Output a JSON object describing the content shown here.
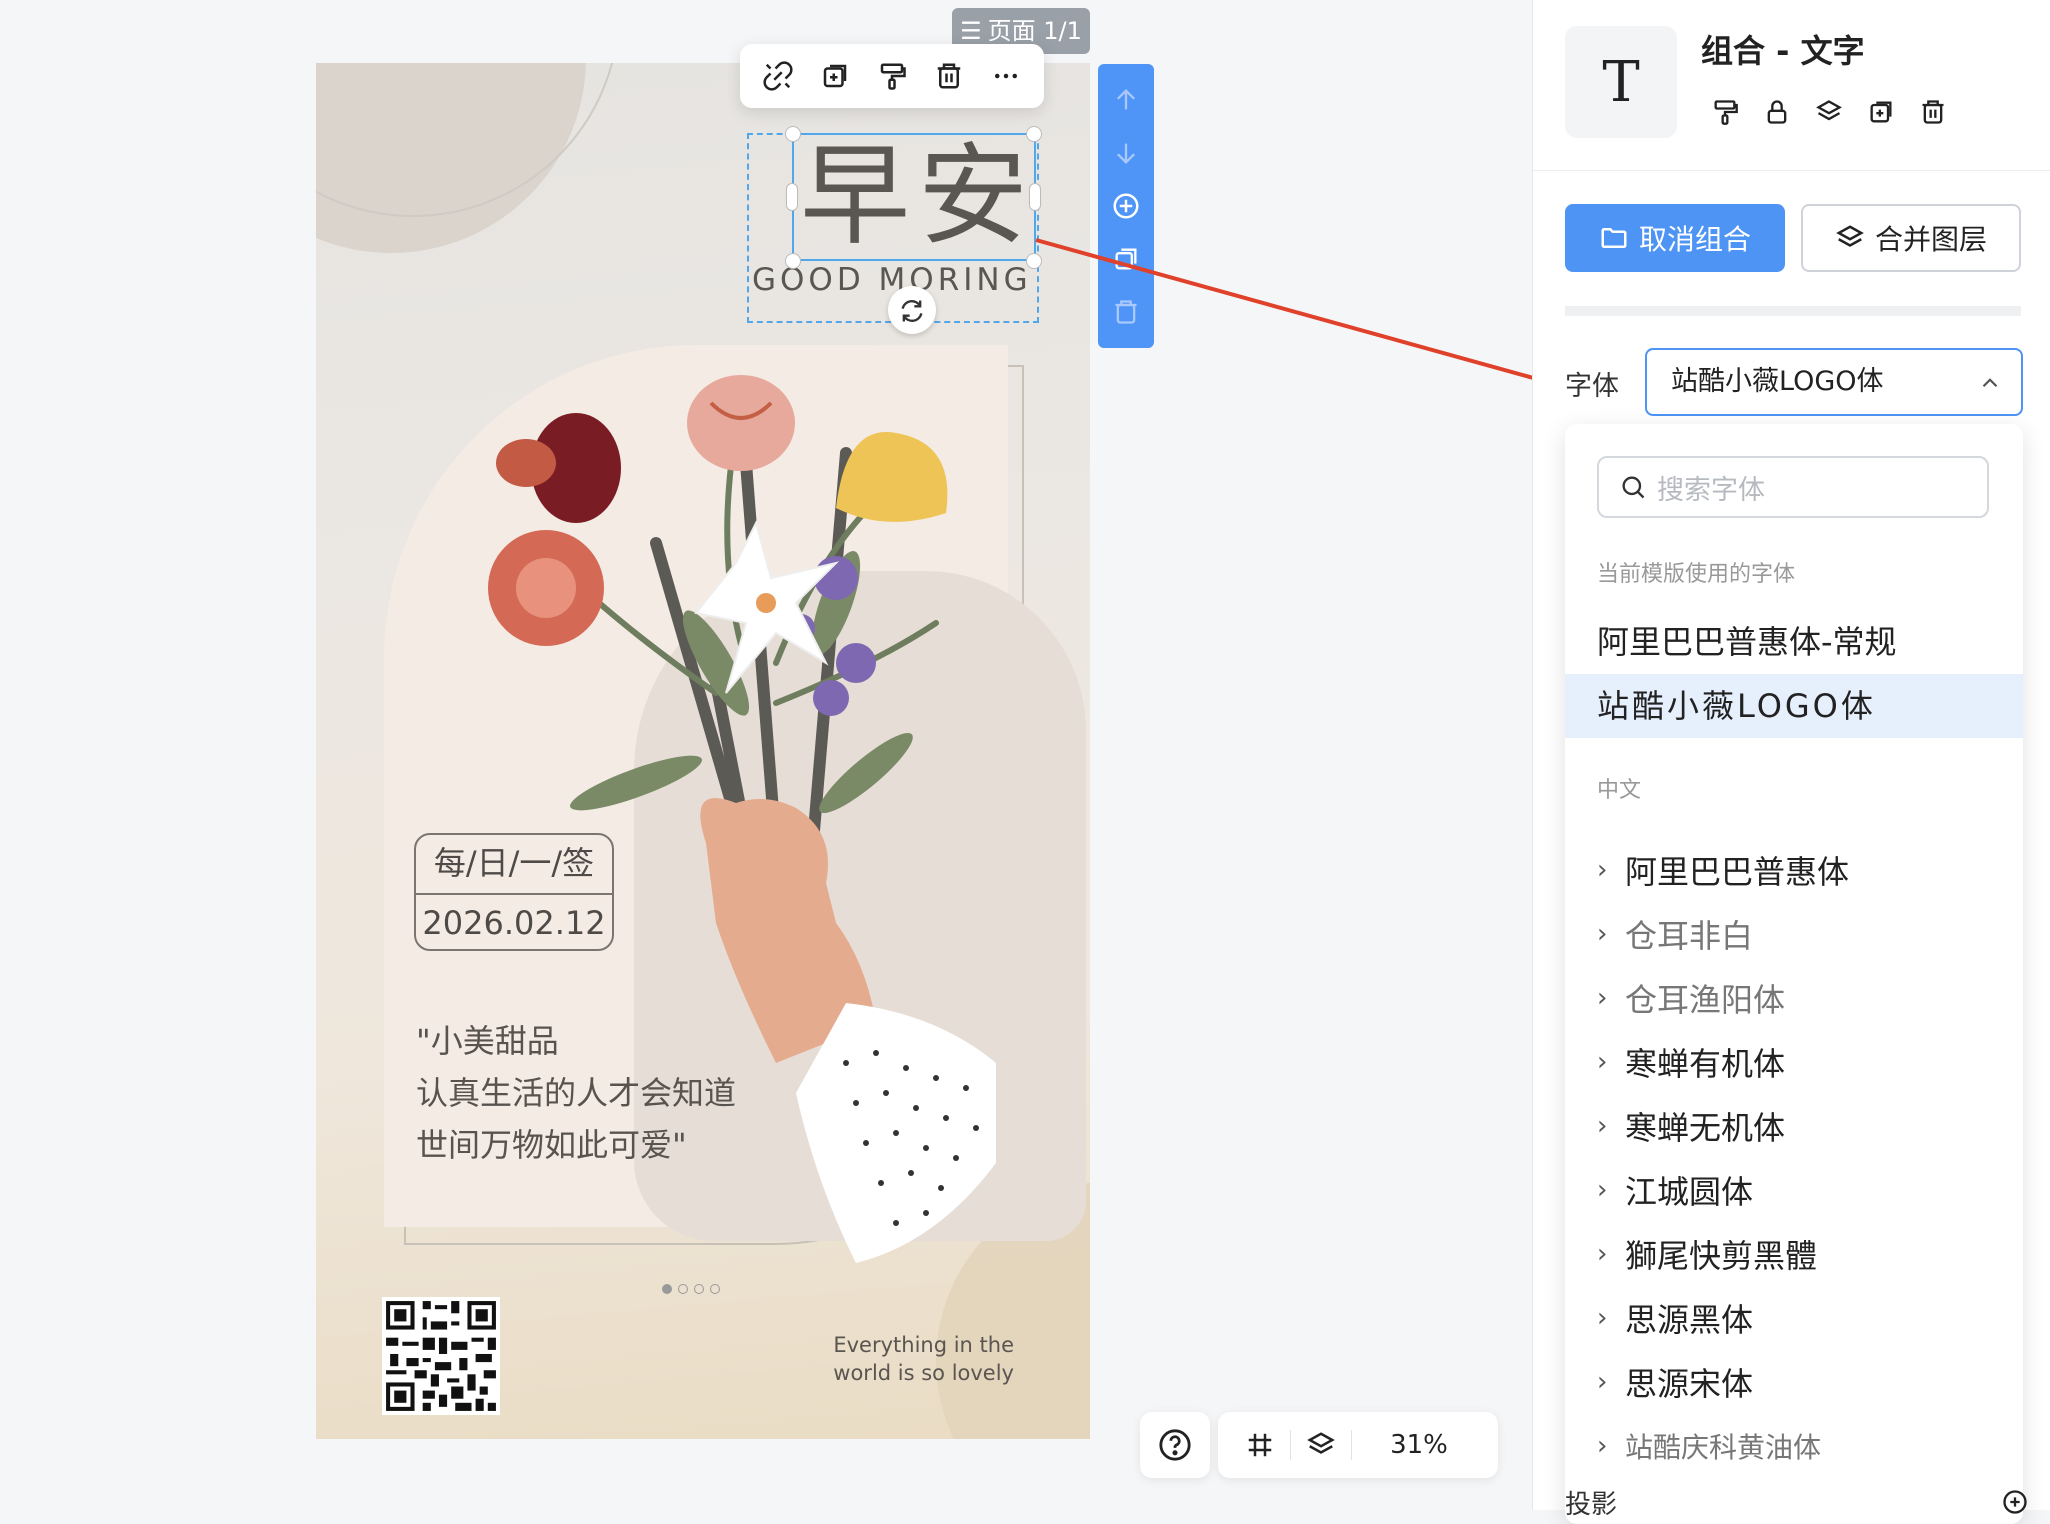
{
  "canvas": {
    "page_indicator": "页面 1/1",
    "title_cn": "早安",
    "title_en": "GOOD MORING",
    "date_label": "每/日/一/签",
    "date_value": "2026.02.12",
    "quote_lines": [
      "\"小美甜品",
      "认真生活的人才会知道",
      "世间万物如此可爱\""
    ],
    "tagline_lines": [
      "Everything in the",
      "world is so lovely"
    ],
    "zoom": "31%"
  },
  "panel": {
    "title": "组合 - 文字",
    "thumb_glyph": "T",
    "ungroup_label": "取消组合",
    "merge_label": "合并图层",
    "font_label": "字体",
    "font_value": "站酷小薇LOGO体",
    "search_placeholder": "搜索字体",
    "template_heading": "当前模版使用的字体",
    "template_fonts": [
      "阿里巴巴普惠体-常规",
      "站酷小薇LOGO体"
    ],
    "chinese_heading": "中文",
    "chinese_fonts": [
      "阿里巴巴普惠体",
      "仓耳非白",
      "仓耳渔阳体",
      "寒蝉有机体",
      "寒蝉无机体",
      "江城圆体",
      "獅尾快剪黑體",
      "思源黑体",
      "思源宋体",
      "站酷庆科黄油体"
    ],
    "shadow_label": "投影"
  },
  "colors": {
    "accent": "#4d94f5",
    "arrow": "#e0412b",
    "selection": "#52a7ea"
  }
}
